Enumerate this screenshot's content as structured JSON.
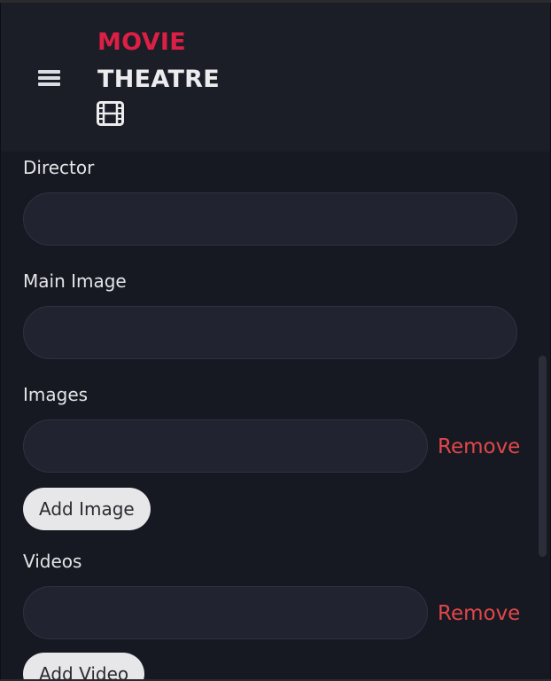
{
  "header": {
    "brand_line1": "MOVIE",
    "brand_line2": "THEATRE",
    "menu_icon": "hamburger-menu-icon",
    "logo_icon": "film-icon"
  },
  "form": {
    "director": {
      "label": "Director",
      "value": ""
    },
    "main_image": {
      "label": "Main Image",
      "value": ""
    },
    "images": {
      "label": "Images",
      "items": [
        ""
      ],
      "remove_label": "Remove",
      "add_label": "Add Image"
    },
    "videos": {
      "label": "Videos",
      "items": [
        ""
      ],
      "remove_label": "Remove",
      "add_label": "Add Video"
    }
  },
  "colors": {
    "background": "#161921",
    "header_background": "#1b1e27",
    "brand_accent": "#dc1f44",
    "input_background": "#212430",
    "remove_link": "#e1474a",
    "button_background": "#e7e7ea"
  }
}
